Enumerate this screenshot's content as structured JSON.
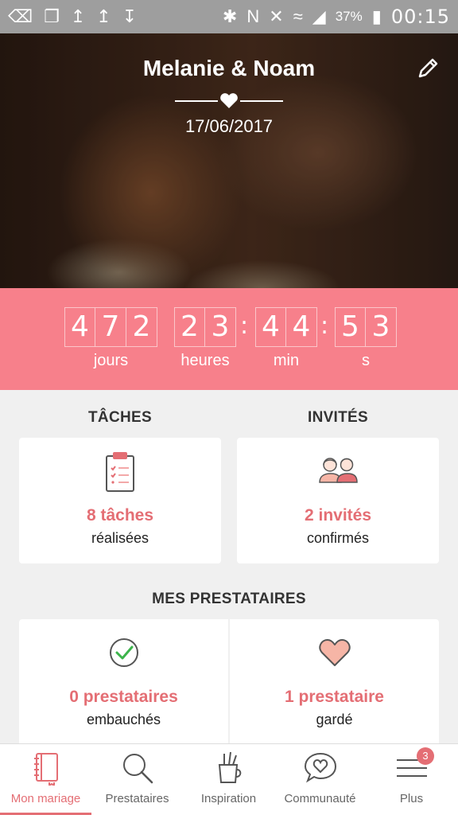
{
  "status_bar": {
    "battery": "37%",
    "time": "00:15"
  },
  "hero": {
    "couple": "Melanie & Noam",
    "date": "17/06/2017"
  },
  "countdown": {
    "days": [
      "4",
      "7",
      "2"
    ],
    "hours": [
      "2",
      "3"
    ],
    "minutes": [
      "4",
      "4"
    ],
    "seconds": [
      "5",
      "3"
    ],
    "labels": {
      "days": "jours",
      "hours": "heures",
      "minutes": "min",
      "seconds": "s"
    }
  },
  "tasks": {
    "title": "TÂCHES",
    "main": "8 tâches",
    "sub": "réalisées"
  },
  "guests": {
    "title": "INVITÉS",
    "main": "2 invités",
    "sub": "confirmés"
  },
  "vendors": {
    "title": "MES PRESTATAIRES",
    "hired": {
      "main": "0 prestataires",
      "sub": "embauchés"
    },
    "saved": {
      "main": "1 prestataire",
      "sub": "gardé"
    }
  },
  "nav": {
    "items": [
      {
        "label": "Mon mariage",
        "icon": "notebook-icon"
      },
      {
        "label": "Prestataires",
        "icon": "search-icon"
      },
      {
        "label": "Inspiration",
        "icon": "brushes-icon"
      },
      {
        "label": "Communauté",
        "icon": "chat-heart-icon"
      },
      {
        "label": "Plus",
        "icon": "menu-icon"
      }
    ],
    "badge": "3"
  },
  "colors": {
    "accent": "#e46e74",
    "countdown_bg": "#f7808b",
    "status_bar": "#9e9e9e"
  }
}
